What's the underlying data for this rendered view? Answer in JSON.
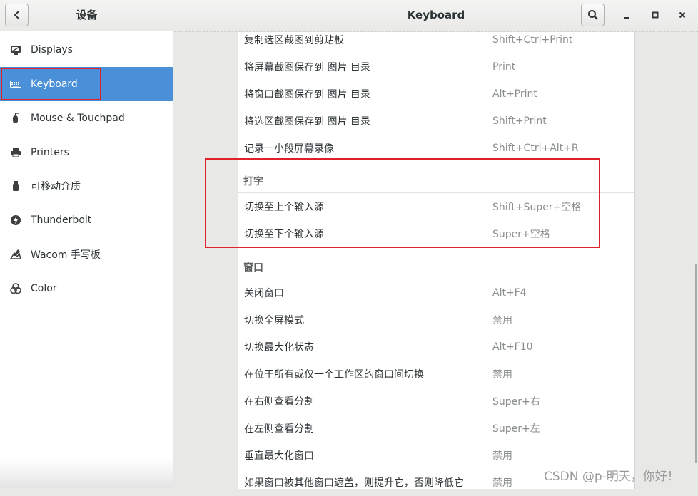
{
  "header": {
    "left_title": "设备",
    "title": "Keyboard",
    "back_icon": "chevron-left-icon",
    "search_icon": "search-icon",
    "minimize_label": "_",
    "maximize_label": "□",
    "close_label": "×"
  },
  "sidebar": {
    "items": [
      {
        "label": "Displays",
        "icon": "display-icon"
      },
      {
        "label": "Keyboard",
        "icon": "keyboard-icon",
        "selected": true
      },
      {
        "label": "Mouse & Touchpad",
        "icon": "mouse-icon"
      },
      {
        "label": "Printers",
        "icon": "printer-icon"
      },
      {
        "label": "可移动介质",
        "icon": "usb-icon"
      },
      {
        "label": "Thunderbolt",
        "icon": "thunderbolt-icon"
      },
      {
        "label": "Wacom 手写板",
        "icon": "tablet-icon"
      },
      {
        "label": "Color",
        "icon": "color-icon"
      }
    ]
  },
  "shortcuts": {
    "screenshot_rows": [
      {
        "name": "复制选区截图到剪贴板",
        "accel": "Shift+Ctrl+Print"
      },
      {
        "name": "将屏幕截图保存到 图片 目录",
        "accel": "Print"
      },
      {
        "name": "将窗口截图保存到 图片 目录",
        "accel": "Alt+Print"
      },
      {
        "name": "将选区截图保存到 图片 目录",
        "accel": "Shift+Print"
      },
      {
        "name": "记录一小段屏幕录像",
        "accel": "Shift+Ctrl+Alt+R"
      }
    ],
    "typing_section": "打字",
    "typing_rows": [
      {
        "name": "切换至上个输入源",
        "accel": "Shift+Super+空格"
      },
      {
        "name": "切换至下个输入源",
        "accel": "Super+空格"
      }
    ],
    "window_section": "窗口",
    "window_rows": [
      {
        "name": "关闭窗口",
        "accel": "Alt+F4"
      },
      {
        "name": "切换全屏模式",
        "accel": "禁用"
      },
      {
        "name": "切换最大化状态",
        "accel": "Alt+F10"
      },
      {
        "name": "在位于所有或仅一个工作区的窗口间切换",
        "accel": "禁用"
      },
      {
        "name": "在右侧查看分割",
        "accel": "Super+右"
      },
      {
        "name": "在左侧查看分割",
        "accel": "Super+左"
      },
      {
        "name": "垂直最大化窗口",
        "accel": "禁用"
      },
      {
        "name": "如果窗口被其他窗口遮盖，则提升它，否则降低它",
        "accel": "禁用"
      }
    ]
  },
  "watermark": "CSDN @p-明天，你好！",
  "colors": {
    "accent": "#4a90d9",
    "highlight": "#e0202a"
  }
}
